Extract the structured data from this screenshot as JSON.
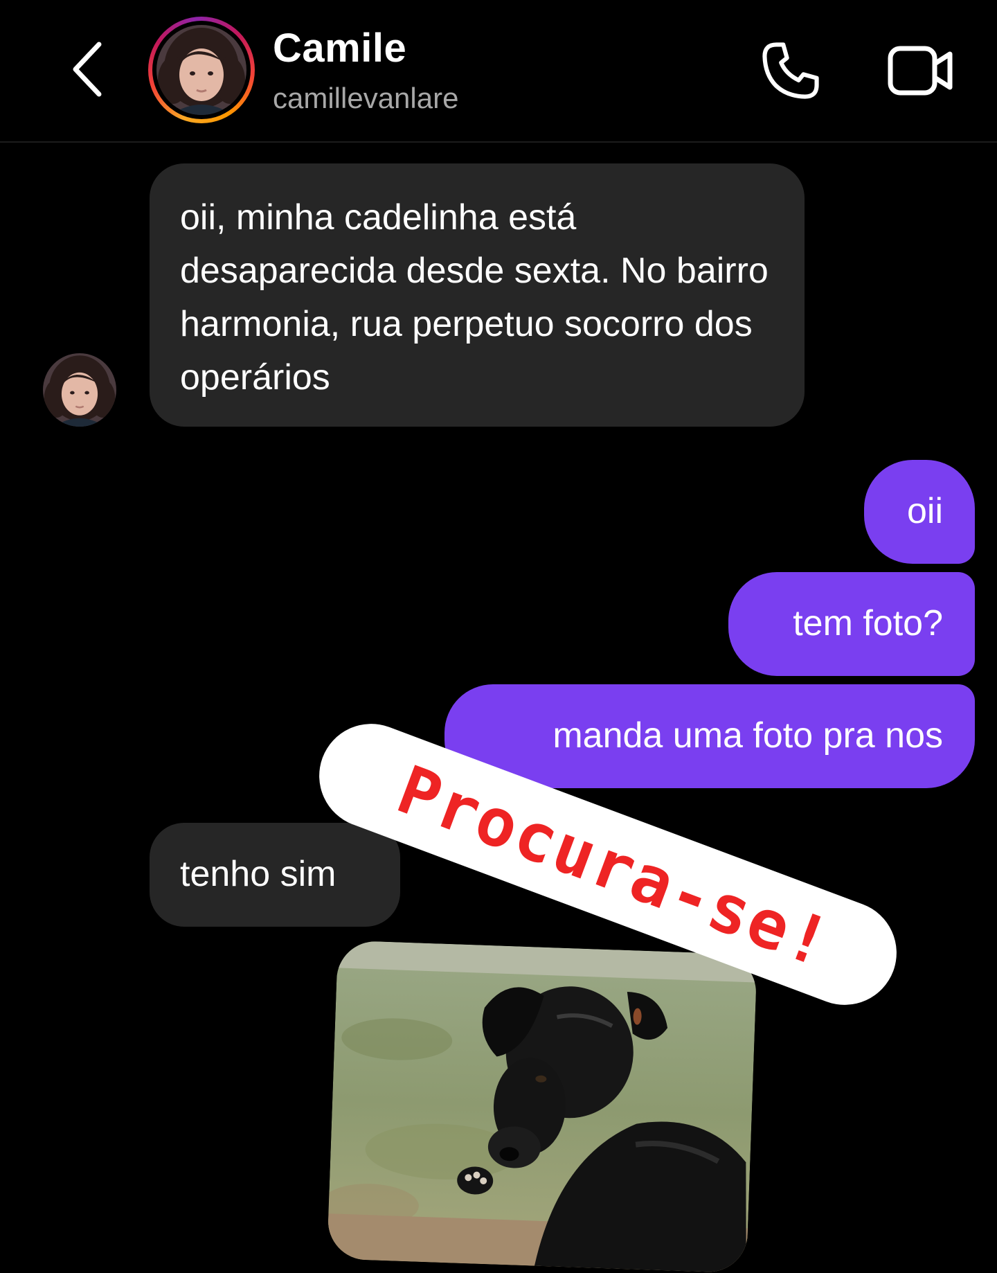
{
  "header": {
    "contact_name": "Camile",
    "username": "camillevanlare",
    "back_icon": "chevron-left-icon",
    "call_icon": "phone-icon",
    "video_icon": "video-camera-icon",
    "avatar_ring_colors": [
      "#f9a825",
      "#f44336",
      "#c2185b",
      "#8e24aa"
    ]
  },
  "messages": [
    {
      "direction": "incoming",
      "text": "oii, minha cadelinha está desaparecida desde sexta. No bairro harmonia, rua perpetuo socorro dos operários"
    },
    {
      "direction": "outgoing",
      "text": "oii"
    },
    {
      "direction": "outgoing",
      "text": "tem foto?"
    },
    {
      "direction": "outgoing",
      "text": "manda uma foto pra nos"
    },
    {
      "direction": "incoming",
      "text": "tenho sim"
    },
    {
      "direction": "incoming",
      "type": "photo",
      "subject": "black dog on grass"
    }
  ],
  "sticker": {
    "text": "Procura-se!",
    "text_color": "#ee2424",
    "background": "#ffffff"
  },
  "colors": {
    "background": "#000000",
    "incoming_bubble": "#262626",
    "outgoing_bubble": "#7a3ff0",
    "username": "#a8a8a8"
  }
}
